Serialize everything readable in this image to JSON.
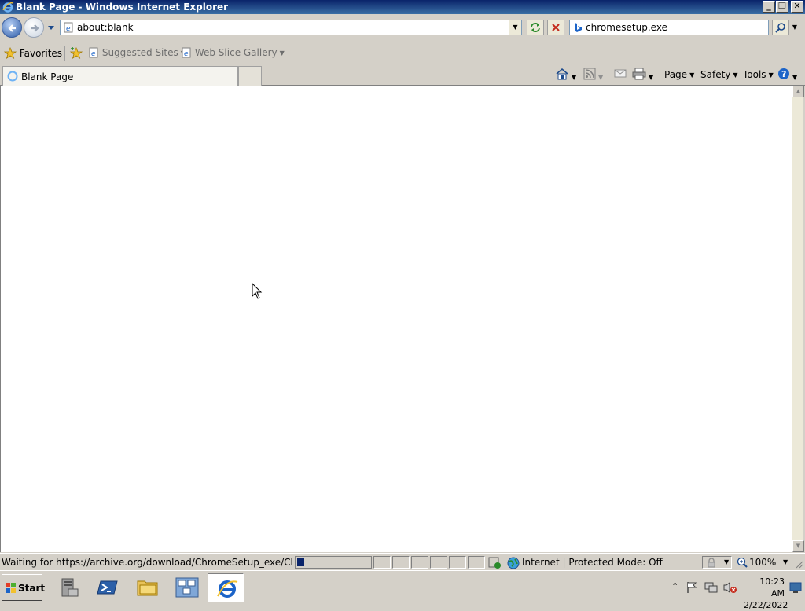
{
  "window": {
    "title": "Blank Page - Windows Internet Explorer",
    "controls": {
      "minimize": "_",
      "restore": "❐",
      "close": "✕"
    }
  },
  "navigation": {
    "address": "about:blank",
    "search_value": "chromesetup.exe",
    "search_engine_icon": "bing-icon"
  },
  "favorites_bar": {
    "favorites_label": "Favorites",
    "items": [
      {
        "label": "Suggested Sites"
      },
      {
        "label": "Web Slice Gallery"
      }
    ]
  },
  "tabs": [
    {
      "label": "Blank Page",
      "active": true
    }
  ],
  "command_bar": {
    "page_label": "Page",
    "safety_label": "Safety",
    "tools_label": "Tools"
  },
  "status_bar": {
    "status_text": "Waiting for https://archive.org/download/ChromeSetup_exe/ChromeSetup.e",
    "progress_fraction": 0.1,
    "zone_text": "Internet | Protected Mode: Off",
    "zoom": "100%"
  },
  "taskbar": {
    "start_label": "Start",
    "apps": [
      {
        "icon": "server-manager-icon"
      },
      {
        "icon": "powershell-icon"
      },
      {
        "icon": "folder-icon"
      },
      {
        "icon": "network-icon"
      },
      {
        "icon": "internet-explorer-icon",
        "active": true
      }
    ],
    "time": "10:23 AM",
    "date": "2/22/2022"
  },
  "colors": {
    "titlebar_start": "#0a246a",
    "titlebar_end": "#3a6ea5",
    "chrome": "#d4d0c8",
    "ie_blue": "#1c64c8"
  }
}
